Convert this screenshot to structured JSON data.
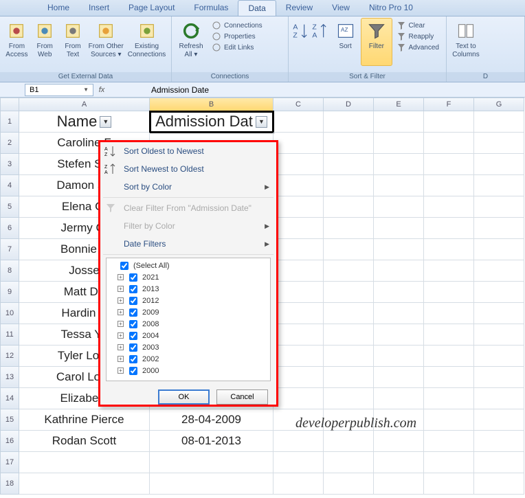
{
  "tabs": [
    "Home",
    "Insert",
    "Page Layout",
    "Formulas",
    "Data",
    "Review",
    "View",
    "Nitro Pro 10"
  ],
  "active_tab": "Data",
  "ribbon": {
    "get_external": {
      "label": "Get External Data",
      "buttons": [
        "From Access",
        "From Web",
        "From Text",
        "From Other Sources ▾",
        "Existing Connections"
      ]
    },
    "connections": {
      "label": "Connections",
      "refresh": "Refresh All ▾",
      "lines": [
        "Connections",
        "Properties",
        "Edit Links"
      ]
    },
    "sortfilter": {
      "label": "Sort & Filter",
      "sort": "Sort",
      "filter": "Filter",
      "lines": [
        "Clear",
        "Reapply",
        "Advanced"
      ]
    },
    "datatools": {
      "textcol": "Text to Columns"
    }
  },
  "namebox": "B1",
  "formula": "Admission Date",
  "columns": [
    "A",
    "B",
    "C",
    "D",
    "E",
    "F",
    "G"
  ],
  "rows": [
    {
      "n": 1,
      "a": "Name",
      "b": "Admission Dat"
    },
    {
      "n": 2,
      "a": "Caroline F",
      "b": ""
    },
    {
      "n": 3,
      "a": "Stefen Sal",
      "b": ""
    },
    {
      "n": 4,
      "a": "Damon Sa",
      "b": ""
    },
    {
      "n": 5,
      "a": "Elena Gi",
      "b": ""
    },
    {
      "n": 6,
      "a": "Jermy Gi",
      "b": ""
    },
    {
      "n": 7,
      "a": "Bonnie B",
      "b": ""
    },
    {
      "n": 8,
      "a": "Josse",
      "b": ""
    },
    {
      "n": 9,
      "a": "Matt Do",
      "b": ""
    },
    {
      "n": 10,
      "a": "Hardin S",
      "b": ""
    },
    {
      "n": 11,
      "a": "Tessa Yo",
      "b": ""
    },
    {
      "n": 12,
      "a": "Tyler Lock",
      "b": ""
    },
    {
      "n": 13,
      "a": "Carol Lock",
      "b": ""
    },
    {
      "n": 14,
      "a": "Elizabeth",
      "b": ""
    },
    {
      "n": 15,
      "a": "Kathrine Pierce",
      "b": "28-04-2009"
    },
    {
      "n": 16,
      "a": "Rodan Scott",
      "b": "08-01-2013"
    },
    {
      "n": 17,
      "a": "",
      "b": ""
    },
    {
      "n": 18,
      "a": "",
      "b": ""
    }
  ],
  "menu": {
    "sort_old": "Sort Oldest to Newest",
    "sort_new": "Sort Newest to Oldest",
    "sort_color": "Sort by Color",
    "clear_filter": "Clear Filter From \"Admission Date\"",
    "filter_color": "Filter by Color",
    "date_filters": "Date Filters",
    "select_all": "(Select All)",
    "years": [
      "2021",
      "2013",
      "2012",
      "2009",
      "2008",
      "2004",
      "2003",
      "2002",
      "2000"
    ],
    "ok": "OK",
    "cancel": "Cancel"
  },
  "watermark": "developerpublish.com"
}
